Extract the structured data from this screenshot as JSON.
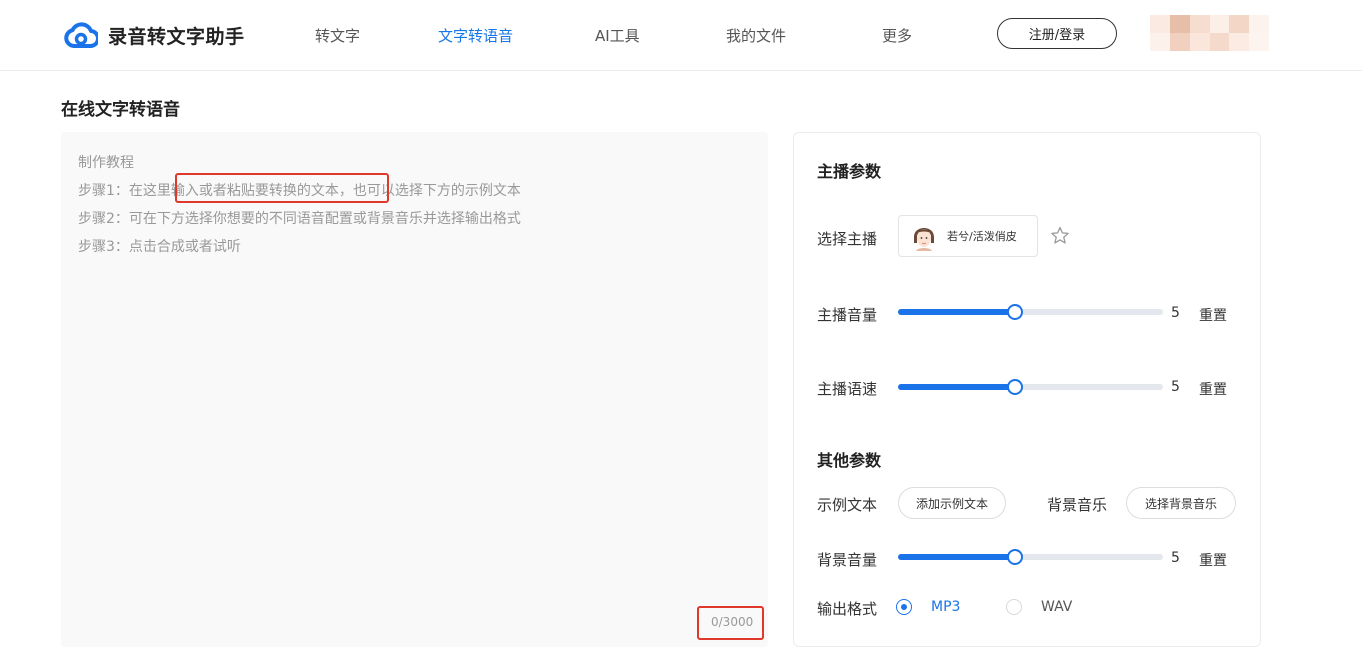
{
  "header": {
    "logo_text": "录音转文字助手",
    "nav": [
      "转文字",
      "文字转语音",
      "AI工具",
      "我的文件",
      "更多"
    ],
    "active_nav": "文字转语音",
    "login_label": "注册/登录"
  },
  "page_title": "在线文字转语音",
  "editor": {
    "lines": [
      "制作教程",
      "步骤1：在这里输入或者粘贴要转换的文本，也可以选择下方的示例文本",
      "步骤2：可在下方选择你想要的不同语音配置或背景音乐并选择输出格式",
      "步骤3：点击合成或者试听"
    ],
    "counter": "0/3000"
  },
  "panel": {
    "anchor_section_title": "主播参数",
    "select_anchor_label": "选择主播",
    "anchor_name": "若兮/活泼俏皮",
    "volume_label": "主播音量",
    "volume_value": "5",
    "volume_level": 0.44,
    "speed_label": "主播语速",
    "speed_value": "5",
    "speed_level": 0.44,
    "reset_label": "重置",
    "other_section_title": "其他参数",
    "sample_text_label": "示例文本",
    "add_sample_button": "添加示例文本",
    "bg_music_label": "背景音乐",
    "select_bg_music_button": "选择背景音乐",
    "bg_volume_label": "背景音量",
    "bg_volume_value": "5",
    "bg_volume_level": 0.44,
    "format_label": "输出格式",
    "formats": [
      "MP3",
      "WAV"
    ],
    "selected_format": "MP3"
  },
  "colors": {
    "accent": "#1a73e8",
    "highlight_box": "#e0382b",
    "nav_active": "#1677e8"
  },
  "icons": {
    "logo": "cloud-logo-icon",
    "favorite": "star-icon",
    "anchor_avatar": "anchor-avatar-icon"
  }
}
